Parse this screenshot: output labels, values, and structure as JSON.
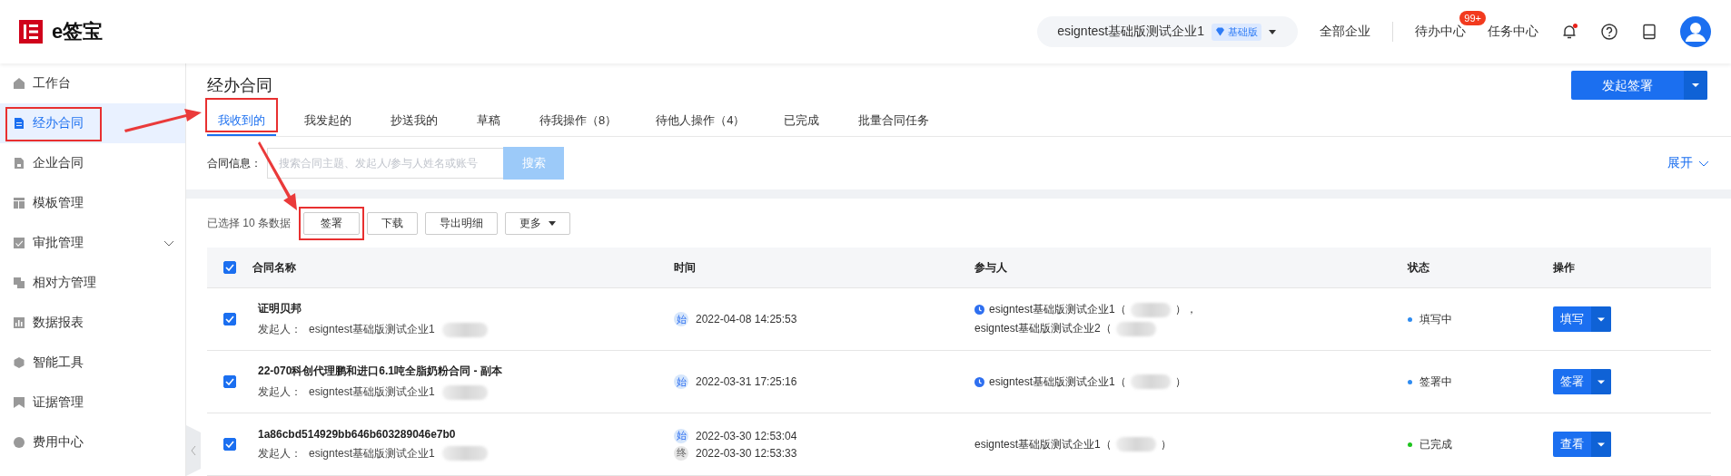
{
  "header": {
    "logo_text": "e签宝",
    "org_name": "esigntest基础版测试企业1",
    "org_tier": "基础版",
    "links": [
      {
        "label": "全部企业"
      },
      {
        "label": "待办中心",
        "badge": "99+"
      },
      {
        "label": "任务中心"
      }
    ],
    "notification_dot": true
  },
  "sidebar": {
    "items": [
      {
        "label": "工作台",
        "selected": false,
        "highlighted": false
      },
      {
        "label": "经办合同",
        "selected": true,
        "highlighted": true
      },
      {
        "label": "企业合同",
        "selected": false,
        "highlighted": false
      },
      {
        "label": "模板管理",
        "selected": false,
        "highlighted": false
      },
      {
        "label": "审批管理",
        "selected": false,
        "highlighted": false,
        "expandable": true
      },
      {
        "label": "相对方管理",
        "selected": false,
        "highlighted": false
      },
      {
        "label": "数据报表",
        "selected": false,
        "highlighted": false
      },
      {
        "label": "智能工具",
        "selected": false,
        "highlighted": false
      },
      {
        "label": "证据管理",
        "selected": false,
        "highlighted": false
      },
      {
        "label": "费用中心",
        "selected": false,
        "highlighted": false
      }
    ]
  },
  "page": {
    "title": "经办合同",
    "primary_button": "发起签署",
    "tabs": [
      {
        "label": "我收到的",
        "selected": true,
        "highlighted": true
      },
      {
        "label": "我发起的",
        "selected": false,
        "highlighted": false
      },
      {
        "label": "抄送我的",
        "selected": false,
        "highlighted": false
      },
      {
        "label": "草稿",
        "selected": false,
        "highlighted": false
      },
      {
        "label": "待我操作（8）",
        "selected": false,
        "highlighted": false
      },
      {
        "label": "待他人操作（4）",
        "selected": false,
        "highlighted": false
      },
      {
        "label": "已完成",
        "selected": false,
        "highlighted": false
      },
      {
        "label": "批量合同任务",
        "selected": false,
        "highlighted": false
      }
    ],
    "search": {
      "label": "合同信息：",
      "placeholder": "搜索合同主题、发起人/参与人姓名或账号",
      "button": "搜索",
      "expand": "展开"
    },
    "selection_info": "已选择 10 条数据",
    "actions": [
      {
        "label": "签署",
        "highlighted": true,
        "dropdown": false
      },
      {
        "label": "下载",
        "highlighted": false,
        "dropdown": false
      },
      {
        "label": "导出明细",
        "highlighted": false,
        "dropdown": false
      },
      {
        "label": "更多",
        "highlighted": false,
        "dropdown": true
      }
    ]
  },
  "table": {
    "select_all_checked": true,
    "columns": [
      "合同名称",
      "时间",
      "参与人",
      "状态",
      "操作"
    ],
    "rows": [
      {
        "checked": true,
        "title": "证明贝邦",
        "initiator_label": "发起人：",
        "initiator": "esigntest基础版测试企业1",
        "times": [
          {
            "kind": "start",
            "badge": "始",
            "time": "2022-04-08 14:25:53"
          }
        ],
        "participants": [
          {
            "name": "esigntest基础版测试企业1（",
            "suffix": "），",
            "pending": true
          },
          {
            "name": "esigntest基础版测试企业2（",
            "pending": false
          }
        ],
        "status": "填写中",
        "color": "#2e8bf0",
        "action": "填写"
      },
      {
        "checked": true,
        "title": "22-070科创代理鹏和进口6.1吨全脂奶粉合同 - 副本",
        "initiator_label": "发起人：",
        "initiator": "esigntest基础版测试企业1",
        "times": [
          {
            "kind": "start",
            "badge": "始",
            "time": "2022-03-31 17:25:16"
          }
        ],
        "participants": [
          {
            "name": "esigntest基础版测试企业1（",
            "suffix": "）",
            "pending": true
          }
        ],
        "status": "签署中",
        "color": "#2e8bf0",
        "action": "签署"
      },
      {
        "checked": true,
        "title": "1a86cbd514929bb646b603289046e7b0",
        "initiator_label": "发起人：",
        "initiator": "esigntest基础版测试企业1",
        "times": [
          {
            "kind": "start",
            "badge": "始",
            "time": "2022-03-30 12:53:04"
          },
          {
            "kind": "end",
            "badge": "终",
            "time": "2022-03-30 12:53:33"
          }
        ],
        "participants": [
          {
            "name": "esigntest基础版测试企业1（",
            "suffix": "）",
            "pending": false
          }
        ],
        "status": "已完成",
        "color": "#1ec41e",
        "action": "查看"
      }
    ]
  }
}
